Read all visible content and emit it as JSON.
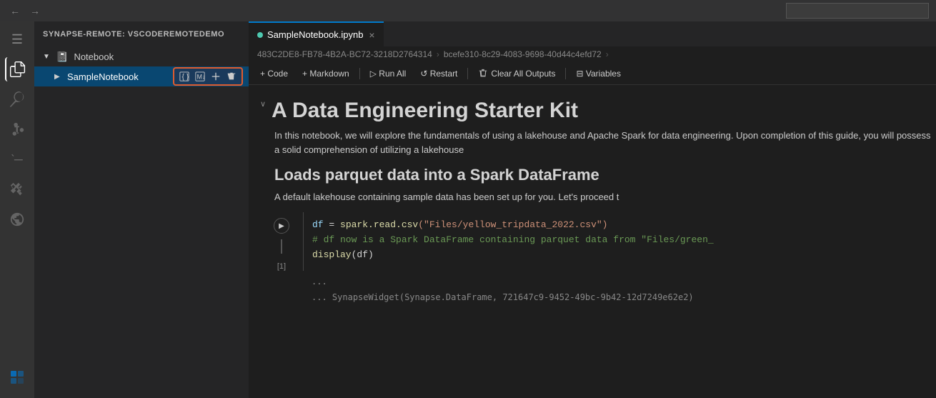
{
  "titlebar": {
    "nav_back": "‹",
    "nav_forward": "›"
  },
  "activitybar": {
    "icons": [
      {
        "name": "menu-icon",
        "glyph": "☰"
      },
      {
        "name": "explorer-icon",
        "glyph": "⎘"
      },
      {
        "name": "search-icon",
        "glyph": "🔍"
      },
      {
        "name": "source-control-icon",
        "glyph": "⑂"
      },
      {
        "name": "run-debug-icon",
        "glyph": "▷"
      },
      {
        "name": "extensions-icon",
        "glyph": "⊞"
      },
      {
        "name": "remote-icon",
        "glyph": "⊟"
      },
      {
        "name": "synapse-icon",
        "glyph": "S"
      }
    ]
  },
  "sidebar": {
    "header": "SYNAPSE-REMOTE: VSCODEREMOTEDEMO",
    "tree": {
      "notebook_section_label": "Notebook",
      "notebook_icon": "📓",
      "sample_notebook_label": "SampleNotebook",
      "row_actions": {
        "add_cell": "⊞",
        "add_markdown": "⊟",
        "move_up": "⬡",
        "delete": "🗑"
      }
    }
  },
  "tabs": {
    "active_tab": {
      "label": "SampleNotebook.ipynb",
      "dot_color": "#4ec9b0",
      "close": "×"
    }
  },
  "breadcrumb": {
    "part1": "483C2DE8-FB78-4B2A-BC72-3218D2764314",
    "sep1": ">",
    "part2": "bcefe310-8c29-4083-9698-40d44c4efd72",
    "sep2": ">"
  },
  "toolbar": {
    "add_code_label": "+ Code",
    "add_markdown_label": "+ Markdown",
    "run_all_label": "▷ Run All",
    "restart_label": "↺ Restart",
    "clear_outputs_label": "Clear All Outputs",
    "variables_label": "⊟ Variables"
  },
  "notebook": {
    "title": "A Data Engineering Starter Kit",
    "intro_text": "In this notebook, we will explore the fundamentals of using a lakehouse and Apache Spark for data engineering. Upon completion of this guide, you will possess a solid comprehension of utilizing a lakehouse",
    "section2_title": "Loads parquet data into a Spark DataFrame",
    "section2_text": "A default lakehouse containing sample data has been set up for you. Let's proceed t",
    "code_cell": {
      "line1_var": "df",
      "line1_op": " = ",
      "line1_func": "spark.read.csv",
      "line1_str": "(\"Files/yellow_tripdata_2022.csv\")",
      "line2_comment": "# df now is a Spark DataFrame containing parquet data from \"Files/green_",
      "line3_func": "display",
      "line3_arg": "(df)",
      "exec_count": "[1]"
    },
    "output_dots_1": "...",
    "output_dots_2": "...",
    "output_widget": "    SynapseWidget(Synapse.DataFrame, 721647c9-9452-49bc-9b42-12d7249e62e2)"
  }
}
